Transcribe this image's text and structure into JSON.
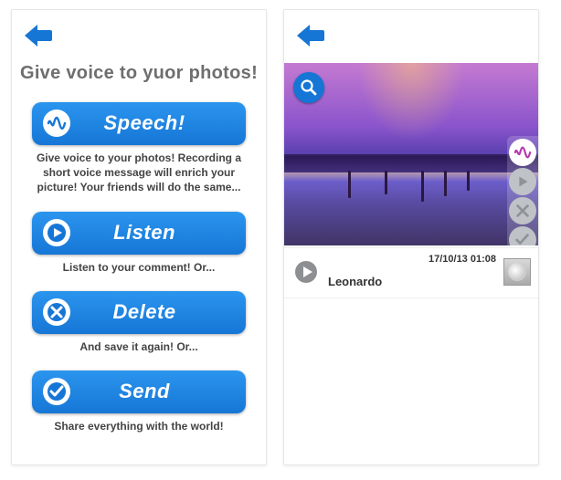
{
  "colors": {
    "accent": "#1676d6"
  },
  "left": {
    "title": "Give voice to yuor photos!",
    "buttons": [
      {
        "id": "speech",
        "label": "Speech!",
        "icon": "waveform-icon",
        "caption": "Give voice to your photos! Recording a short voice message will enrich your picture! Your friends will do the same..."
      },
      {
        "id": "listen",
        "label": "Listen",
        "icon": "play-icon",
        "caption": "Listen to your comment! Or..."
      },
      {
        "id": "delete",
        "label": "Delete",
        "icon": "x-circle-icon",
        "caption": "And save it again! Or..."
      },
      {
        "id": "send",
        "label": "Send",
        "icon": "check-circle-icon",
        "caption": "Share everything with the world!"
      }
    ]
  },
  "right": {
    "side_actions": [
      {
        "id": "speech",
        "icon": "waveform-icon",
        "active": true
      },
      {
        "id": "play",
        "icon": "play-icon"
      },
      {
        "id": "delete",
        "icon": "x-circle-icon"
      },
      {
        "id": "send",
        "icon": "check-circle-icon"
      }
    ],
    "comment": {
      "author": "Leonardo",
      "timestamp": "17/10/13 01:08"
    }
  }
}
